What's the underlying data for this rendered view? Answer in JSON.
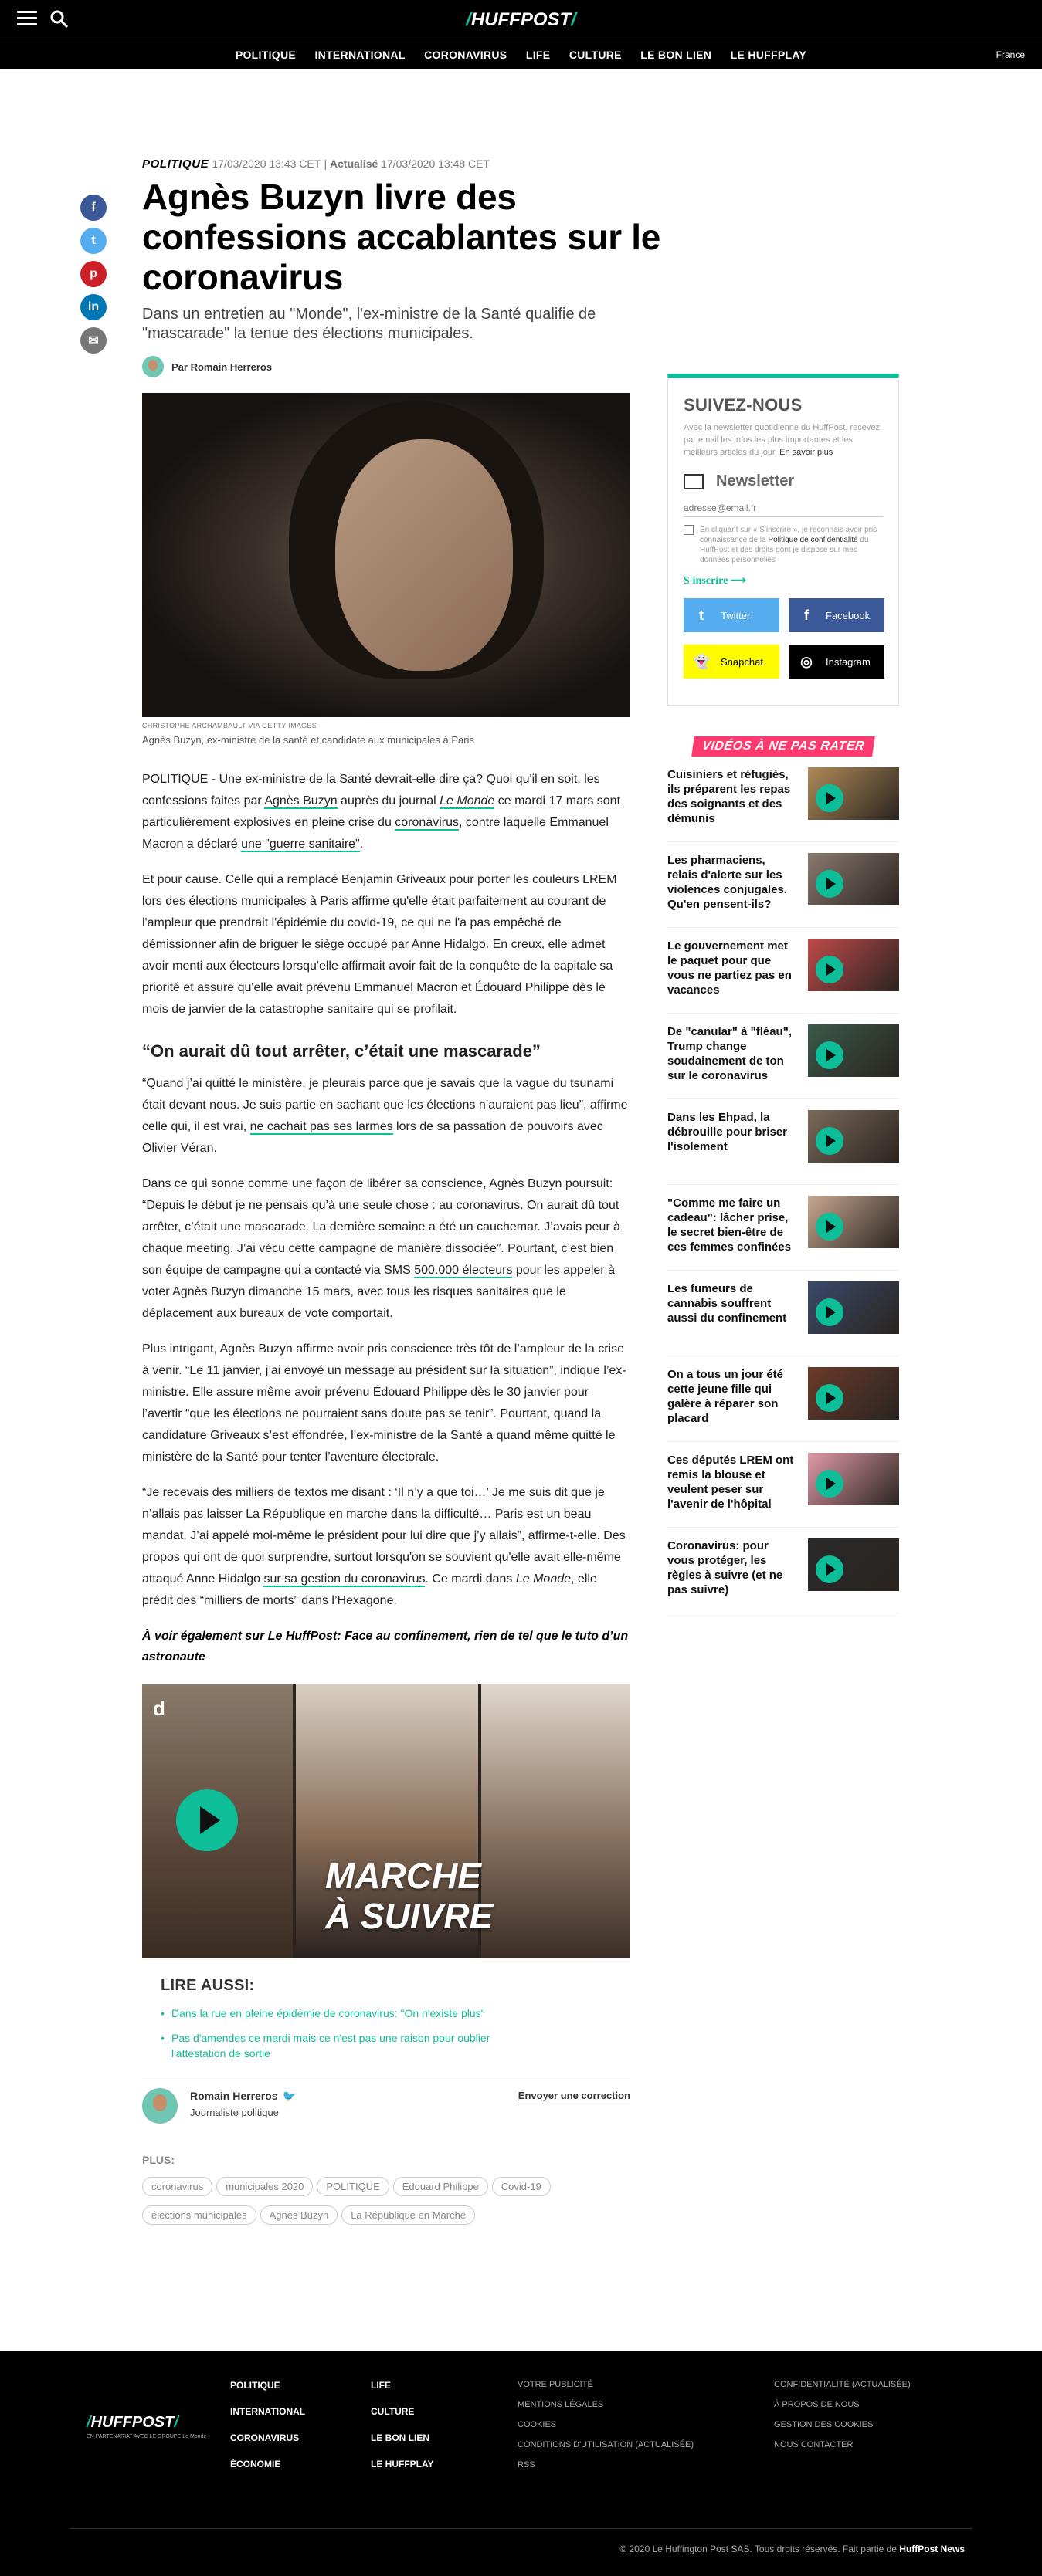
{
  "header": {
    "logo": "HUFFPOST",
    "nav": [
      "POLITIQUE",
      "INTERNATIONAL",
      "CORONAVIRUS",
      "LIFE",
      "CULTURE",
      "LE BON LIEN",
      "LE HUFFPLAY"
    ],
    "edition": "France"
  },
  "article": {
    "section": "POLITIQUE",
    "published": "17/03/2020 13:43 CET",
    "updated_label": "Actualisé",
    "updated": "17/03/2020 13:48 CET",
    "title": "Agnès Buzyn livre des confessions accablantes sur le coronavirus",
    "dek": "Dans un entretien au \"Monde\", l'ex-ministre de la Santé qualifie de \"mascarade\" la tenue des élections municipales.",
    "byline": "Par Romain Herreros",
    "photo_credit": "CHRISTOPHE ARCHAMBAULT VIA GETTY IMAGES",
    "caption": "Agnès Buzyn, ex-ministre de la santé et candidate aux municipales à Paris",
    "p1": {
      "a": "POLITIQUE - Une ex-ministre de la Santé devrait-elle dire ça? Quoi qu'il en soit, les confessions faites par ",
      "l1": "Agnès Buzyn",
      "b": " auprès du journal ",
      "l2": "Le Monde",
      "c": " ce mardi 17 mars sont particulièrement explosives en pleine crise du ",
      "l3": "coronavirus",
      "d": ", contre laquelle Emmanuel Macron a déclaré ",
      "l4": "une \"guerre sanitaire\"",
      "e": "."
    },
    "p2": "Et pour cause. Celle qui a remplacé Benjamin Griveaux pour porter les couleurs LREM lors des élections municipales à Paris affirme qu'elle était parfaitement au courant de l'ampleur que prendrait l'épidémie du covid-19, ce qui ne l'a pas empêché de démissionner afin de briguer le siège occupé par Anne Hidalgo. En creux, elle admet avoir menti aux électeurs lorsqu'elle affirmait avoir fait de la conquête de la capitale sa priorité et assure qu'elle avait prévenu Emmanuel Macron et Édouard Philippe dès le mois de janvier de la catastrophe sanitaire qui se profilait.",
    "h2": "“On aurait dû tout arrêter, c’était une mascarade”",
    "p3": {
      "a": "“Quand j’ai quitté le ministère, je pleurais parce que je savais que la vague du tsunami était devant nous. Je suis partie en sachant que les élections n’auraient pas lieu”, affirme celle qui, il est vrai, ",
      "l1": "ne cachait pas ses larmes",
      "b": " lors de sa passation de pouvoirs avec Olivier Véran."
    },
    "p4": {
      "a": "Dans ce qui sonne comme une façon de libérer sa conscience, Agnès Buzyn poursuit: “Depuis le début je ne pensais qu’à une seule chose : au coronavirus. On aurait dû tout arrêter, c’était une mascarade. La dernière semaine a été un cauchemar. J’avais peur à chaque meeting. J’ai vécu cette campagne de manière dissociée”. Pourtant, c’est bien son équipe de campagne qui a contacté via SMS ",
      "l1": "500.000 électeurs",
      "b": " pour les appeler à voter Agnès Buzyn dimanche 15 mars, avec tous les risques sanitaires que le déplacement aux bureaux de vote comportait."
    },
    "p5": "Plus intrigant, Agnès Buzyn affirme avoir pris conscience très tôt de l’ampleur de la crise à venir. “Le 11 janvier, j’ai envoyé un message au président sur la situation”, indique l’ex-ministre. Elle assure même avoir prévenu Édouard Philippe dès le 30 janvier pour l’avertir “que les élections ne pourraient sans doute pas se tenir”. Pourtant, quand la candidature Griveaux s’est effondrée, l’ex-ministre de la Santé a quand même quitté le ministère de la Santé pour tenter l’aventure électorale.",
    "p6": {
      "a": "“Je recevais des milliers de textos me disant : ‘Il n’y a que toi…’ Je me suis dit que je n’allais pas laisser La République en marche dans la difficulté… Paris est un beau mandat. J’ai appelé moi-même le président pour lui dire que j’y allais”, affirme-t-elle. Des propos qui ont de quoi surprendre, surtout lorsqu'on se souvient qu'elle avait elle-même attaqué Anne Hidalgo ",
      "l1": "sur sa gestion du coronavirus",
      "b": ". Ce mardi dans ",
      "i1": "Le Monde",
      "c": ", elle prédit des “milliers de morts” dans l’Hexagone."
    },
    "voir": "À voir également sur Le HuffPost: Face au confinement, rien de tel que le tuto d’un astronaute",
    "video_title_1": "MARCHE",
    "video_title_2": "À SUIVRE",
    "video_tag": "d",
    "lire_title": "LIRE AUSSI:",
    "lire": [
      "Dans la rue en pleine épidémie de coronavirus: \"On n'existe plus\"",
      "Pas d'amendes ce mardi mais ce n'est pas une raison pour oublier l'attestation de sortie"
    ],
    "author_name": "Romain Herreros",
    "author_role": "Journaliste politique",
    "correction": "Envoyer une correction",
    "plus_title": "PLUS:",
    "tags": [
      "coronavirus",
      "municipales 2020",
      "POLITIQUE",
      "Édouard Philippe",
      "Covid-19",
      "élections municipales",
      "Agnès Buzyn",
      "La République en Marche"
    ]
  },
  "sidebar": {
    "nl_title": "SUIVEZ-NOUS",
    "nl_intro": "Avec la newsletter quotidienne du HuffPost, recevez par email les infos les plus importantes et les meilleurs articles du jour.",
    "nl_more": "En savoir plus",
    "nl_label": "Newsletter",
    "email_placeholder": "adresse@email.fr",
    "consent_a": "En cliquant sur « S'inscrire », je reconnais avoir pris connaissance de la ",
    "consent_b": "Politique de confidentialité",
    "consent_c": " du HuffPost et des droits dont je dispose sur mes données personnelles",
    "subscribe": "S'inscrire",
    "socials": [
      {
        "label": "Twitter",
        "icon": "twitter-icon",
        "color": "#55acee"
      },
      {
        "label": "Facebook",
        "icon": "facebook-icon",
        "color": "#3b5998"
      },
      {
        "label": "Snapchat",
        "icon": "snapchat-icon",
        "color": "#fffc00"
      },
      {
        "label": "Instagram",
        "icon": "instagram-icon",
        "color": "#000000"
      }
    ],
    "videos_title": "VIDÉOS À NE PAS RATER",
    "videos": [
      "Cuisiniers et réfugiés, ils préparent les repas des soignants et des démunis",
      "Les pharmaciens, relais d'alerte sur les violences conjugales. Qu'en pensent-ils?",
      "Le gouvernement met le paquet pour que vous ne partiez pas en vacances",
      "De \"canular\" à \"fléau\", Trump change soudainement de ton sur le coronavirus",
      "Dans les Ehpad, la débrouille pour briser l'isolement",
      "\"Comme me faire un cadeau\": lâcher prise, le secret bien-être de ces femmes confinées",
      "Les fumeurs de cannabis souffrent aussi du confinement",
      "On a tous un jour été cette jeune fille qui galère à réparer son placard",
      "Ces députés LREM ont remis la blouse et veulent peser sur l'avenir de l'hôpital",
      "Coronavirus: pour vous protéger, les règles à suivre (et ne pas suivre)"
    ]
  },
  "footer": {
    "logo": "HUFFPOST",
    "tagline": "EN PARTENARIAT AVEC LE GROUPE Le Monde",
    "col1": [
      "POLITIQUE",
      "INTERNATIONAL",
      "CORONAVIRUS",
      "ÉCONOMIE"
    ],
    "col2": [
      "LIFE",
      "CULTURE",
      "LE BON LIEN",
      "LE HUFFPLAY"
    ],
    "col3": [
      "VOTRE PUBLICITÉ",
      "MENTIONS LÉGALES",
      "COOKIES",
      "CONDITIONS D'UTILISATION (ACTUALISÉE)",
      "RSS"
    ],
    "col4": [
      "CONFIDENTIALITÉ (ACTUALISÉE)",
      "À PROPOS DE NOUS",
      "GESTION DES COOKIES",
      "NOUS CONTACTER"
    ],
    "copyright": "© 2020 Le Huffington Post SAS. Tous droits réservés. Fait partie de ",
    "copyright_brand": "HuffPost News"
  },
  "colors": {
    "accent": "#0dbe98",
    "pink": "#ff3a6e"
  }
}
